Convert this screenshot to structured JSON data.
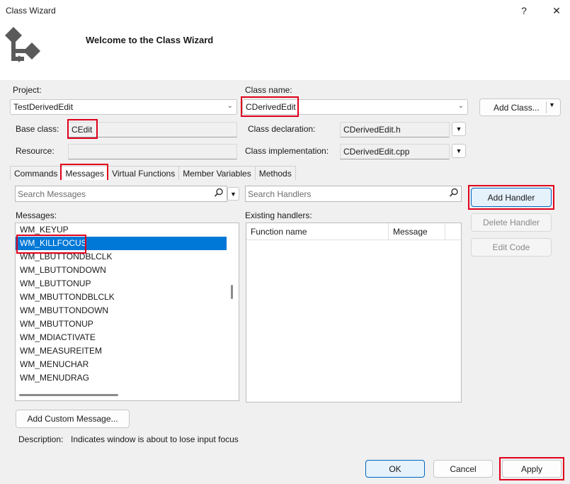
{
  "window": {
    "title": "Class Wizard",
    "help_glyph": "?",
    "close_glyph": "✕"
  },
  "banner": {
    "title": "Welcome to the Class Wizard"
  },
  "project": {
    "label": "Project:",
    "value": "TestDerivedEdit"
  },
  "class_name": {
    "label": "Class name:",
    "value": "CDerivedEdit"
  },
  "add_class": {
    "label": "Add Class..."
  },
  "base_class": {
    "label": "Base class:",
    "value": "CEdit"
  },
  "resource": {
    "label": "Resource:",
    "value": ""
  },
  "class_declaration": {
    "label": "Class declaration:",
    "value": "CDerivedEdit.h"
  },
  "class_implementation": {
    "label": "Class implementation:",
    "value": "CDerivedEdit.cpp"
  },
  "tabs": [
    "Commands",
    "Messages",
    "Virtual Functions",
    "Member Variables",
    "Methods"
  ],
  "messages": {
    "search_placeholder": "Search Messages",
    "label": "Messages:",
    "items": [
      "WM_KEYUP",
      "WM_KILLFOCUS",
      "WM_LBUTTONDBLCLK",
      "WM_LBUTTONDOWN",
      "WM_LBUTTONUP",
      "WM_MBUTTONDBLCLK",
      "WM_MBUTTONDOWN",
      "WM_MBUTTONUP",
      "WM_MDIACTIVATE",
      "WM_MEASUREITEM",
      "WM_MENUCHAR",
      "WM_MENUDRAG"
    ],
    "selected": "WM_KILLFOCUS"
  },
  "handlers": {
    "search_placeholder": "Search Handlers",
    "label": "Existing handlers:",
    "columns": [
      "Function name",
      "Message"
    ]
  },
  "actions": {
    "add_handler": "Add Handler",
    "delete_handler": "Delete Handler",
    "edit_code": "Edit Code",
    "add_custom_message": "Add Custom Message..."
  },
  "description": {
    "label": "Description:",
    "text": "Indicates window is about to lose input focus"
  },
  "footer": {
    "ok": "OK",
    "cancel": "Cancel",
    "apply": "Apply"
  },
  "colors": {
    "selection": "#0078d7",
    "highlight_box": "#e0001b",
    "default_button_border": "#0067c0"
  },
  "icons": {
    "search": "search-icon",
    "dropdown": "chevron-down-icon"
  }
}
